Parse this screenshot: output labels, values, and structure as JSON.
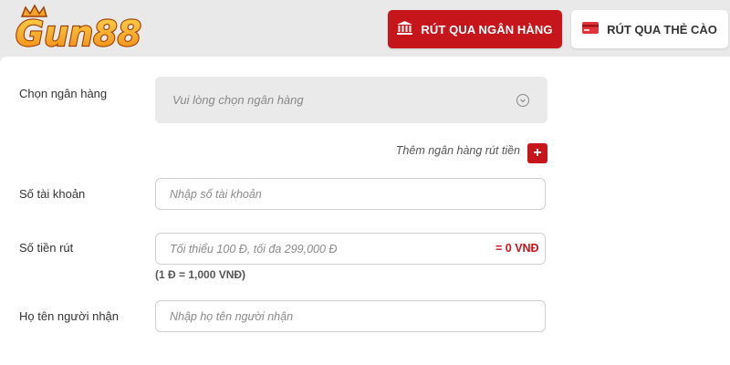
{
  "brand": {
    "logo_text": "GUN88",
    "accent_color": "#c6151b",
    "logo_color": "#f5a623"
  },
  "tabs": [
    {
      "label": "RÚT QUA NGÂN HÀNG",
      "icon": "bank-icon",
      "active": true
    },
    {
      "label": "RÚT QUA THẺ CÀO",
      "icon": "card-icon",
      "active": false
    }
  ],
  "form": {
    "bank": {
      "label": "Chọn ngân hàng",
      "placeholder": "Vui lòng chọn ngân hàng",
      "icon": "chevron-down-icon"
    },
    "add_bank": {
      "label": "Thêm ngân hàng rút tiền",
      "button": "+"
    },
    "account_number": {
      "label": "Số tài khoản",
      "placeholder": "Nhập số tài khoản",
      "value": ""
    },
    "amount": {
      "label": "Số tiền rút",
      "placeholder": "Tối thiểu 100 Đ, tối đa 299,000 Đ",
      "value": "",
      "suffix": "= 0 VNĐ",
      "rate_note": "(1 Đ = 1,000 VNĐ)"
    },
    "recipient_name": {
      "label": "Họ tên người nhận",
      "placeholder": "Nhập họ tên người nhận",
      "value": ""
    }
  }
}
